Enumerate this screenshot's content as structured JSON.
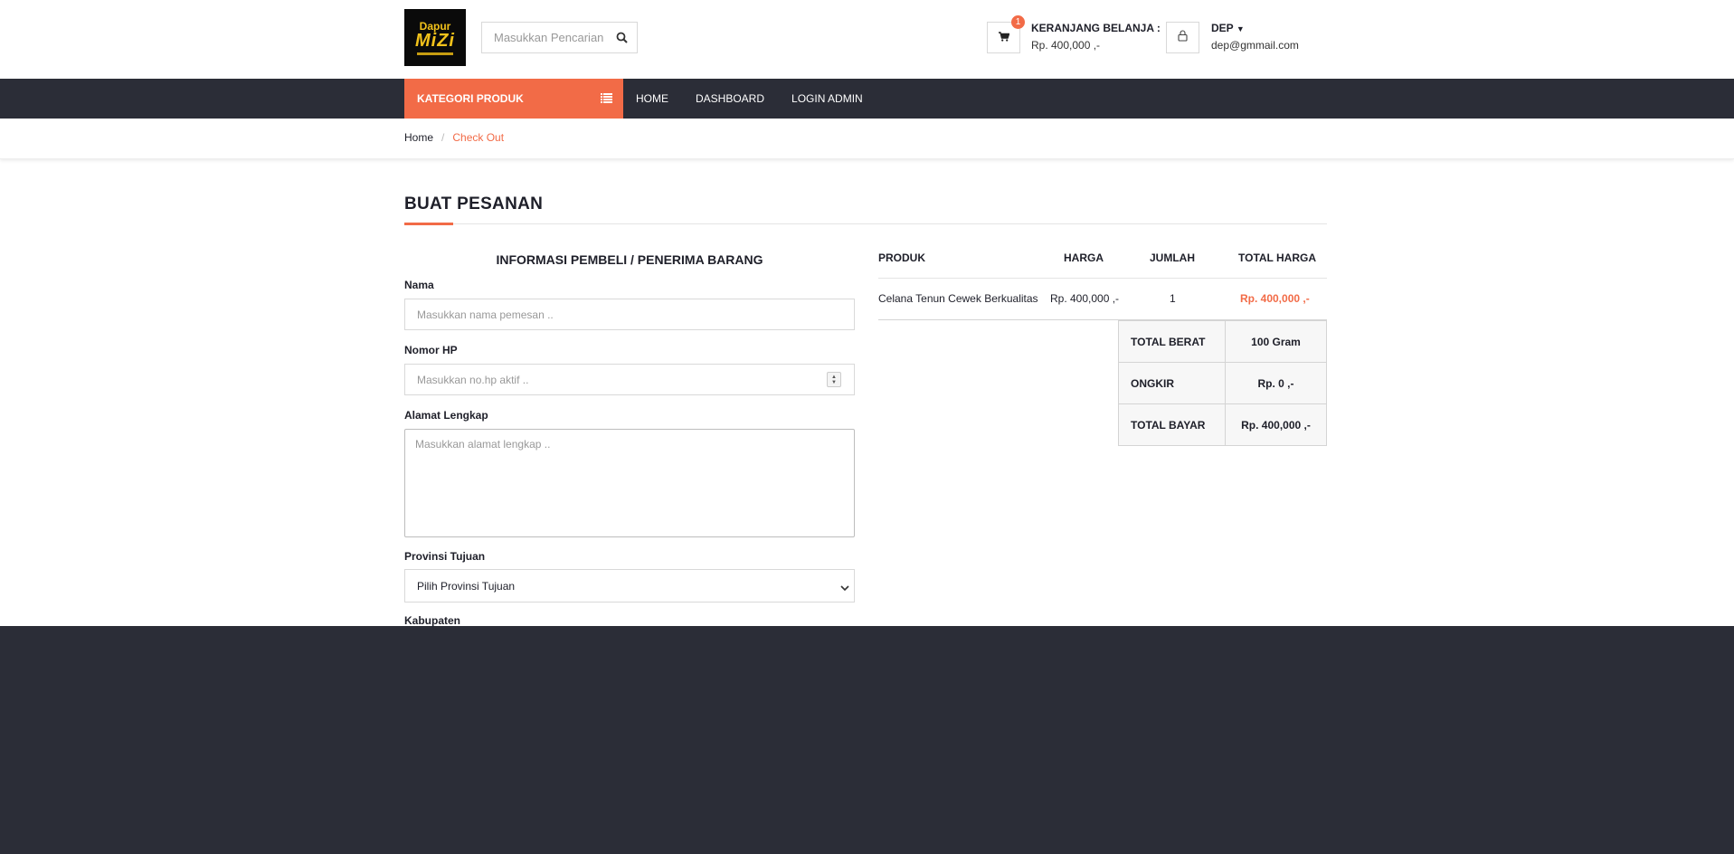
{
  "header": {
    "logo": {
      "line1": "Dapur",
      "line2": "MiZi"
    },
    "search_placeholder": "Masukkan Pencarian ..",
    "cart": {
      "badge": "1",
      "label": "KERANJANG BELANJA :",
      "amount": "Rp. 400,000 ,-"
    },
    "user": {
      "name": "DEP",
      "email": "dep@gmmail.com"
    }
  },
  "nav": {
    "category_label": "KATEGORI PRODUK",
    "links": [
      "HOME",
      "DASHBOARD",
      "LOGIN ADMIN"
    ]
  },
  "breadcrumb": {
    "home": "Home",
    "current": "Check Out"
  },
  "page": {
    "title": "BUAT PESANAN",
    "form_heading": "INFORMASI PEMBELI / PENERIMA BARANG"
  },
  "form": {
    "nama": {
      "label": "Nama",
      "placeholder": "Masukkan nama pemesan .."
    },
    "hp": {
      "label": "Nomor HP",
      "placeholder": "Masukkan no.hp aktif .."
    },
    "alamat": {
      "label": "Alamat Lengkap",
      "placeholder": "Masukkan alamat lengkap .."
    },
    "provinsi": {
      "label": "Provinsi Tujuan",
      "selected": "Pilih Provinsi Tujuan"
    },
    "kabupaten": {
      "label": "Kabupaten"
    }
  },
  "table": {
    "headers": {
      "produk": "PRODUK",
      "harga": "HARGA",
      "jumlah": "JUMLAH",
      "total": "TOTAL HARGA"
    },
    "row": {
      "produk": "Celana Tenun Cewek Berkualitas",
      "harga": "Rp. 400,000 ,-",
      "jumlah": "1",
      "total": "Rp. 400,000 ,-"
    },
    "summary": {
      "berat_label": "TOTAL BERAT",
      "berat_value": "100 Gram",
      "ongkir_label": "ONGKIR",
      "ongkir_value": "Rp. 0 ,-",
      "bayar_label": "TOTAL BAYAR",
      "bayar_value": "Rp. 400,000 ,-"
    }
  },
  "colors": {
    "accent": "#f26b47",
    "dark": "#2b2d37",
    "text": "#1e1f29"
  }
}
